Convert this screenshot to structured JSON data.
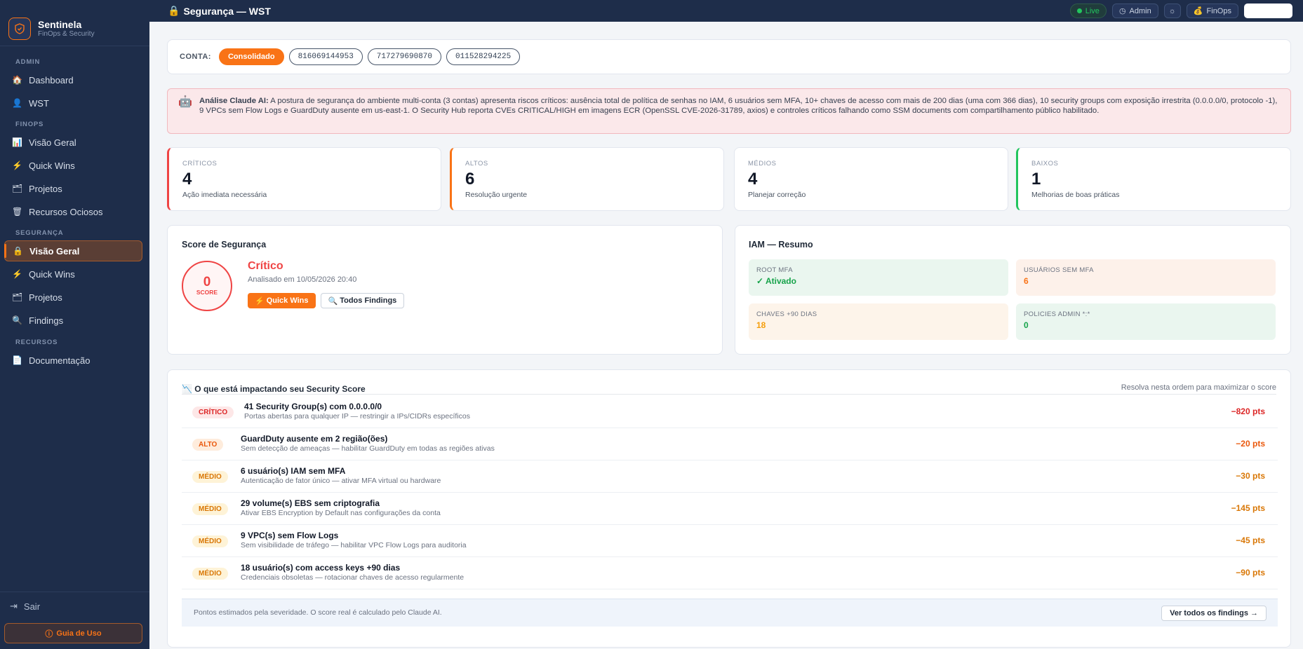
{
  "brand": {
    "name": "Sentinela",
    "subtitle": "FinOps & Security"
  },
  "nav": {
    "sections": [
      {
        "label": "ADMIN"
      },
      {
        "label": "FINOPS"
      },
      {
        "label": "SEGURANÇA"
      },
      {
        "label": "RECURSOS"
      }
    ],
    "items": [
      {
        "label": "Dashboard",
        "icon": "home-icon"
      },
      {
        "label": "WST",
        "icon": "user-icon"
      },
      {
        "label": "Visão Geral",
        "icon": "chart-icon"
      },
      {
        "label": "Quick Wins",
        "icon": "bolt-icon"
      },
      {
        "label": "Projetos",
        "icon": "folder-icon"
      },
      {
        "label": "Recursos Ociosos",
        "icon": "trash-icon"
      },
      {
        "label": "Visão Geral",
        "icon": "lock-icon",
        "active": true
      },
      {
        "label": "Quick Wins",
        "icon": "bolt-icon"
      },
      {
        "label": "Projetos",
        "icon": "folder-icon"
      },
      {
        "label": "Findings",
        "icon": "search-icon"
      },
      {
        "label": "Documentação",
        "icon": "document-icon"
      }
    ],
    "logout": "Sair",
    "guide": "Guia de Uso"
  },
  "topbar": {
    "title": "Segurança — WST",
    "live": "Live",
    "admin": "Admin",
    "finops": "FinOps"
  },
  "accounts": {
    "label": "CONTA:",
    "options": [
      "Consolidado",
      "816069144953",
      "717279690870",
      "011528294225"
    ],
    "selected": "Consolidado"
  },
  "analysis": {
    "title": "Análise Claude AI:",
    "text": "A postura de segurança do ambiente multi-conta (3 contas) apresenta riscos críticos: ausência total de política de senhas no IAM, 6 usuários sem MFA, 10+ chaves de acesso com mais de 200 dias (uma com 366 dias), 10 security groups com exposição irrestrita (0.0.0.0/0, protocolo -1), 9 VPCs sem Flow Logs e GuardDuty ausente em us-east-1. O Security Hub reporta CVEs CRITICAL/HIGH em imagens ECR (OpenSSL CVE-2026-31789, axios) e controles críticos falhando como SSM documents com compartilhamento público habilitado."
  },
  "stats": [
    {
      "label": "CRÍTICOS",
      "value": "4",
      "sub": "Ação imediata necessária",
      "color": "#ef4444"
    },
    {
      "label": "ALTOS",
      "value": "6",
      "sub": "Resolução urgente",
      "color": "#f97316"
    },
    {
      "label": "MÉDIOS",
      "value": "4",
      "sub": "Planejar correção",
      "color": "#e2e6ee"
    },
    {
      "label": "BAIXOS",
      "value": "1",
      "sub": "Melhorias de boas práticas",
      "color": "#22c55e"
    }
  ],
  "score": {
    "title": "Score de Segurança",
    "value": "0",
    "value_label": "SCORE",
    "status": "Crítico",
    "analyzed": "Analisado em 10/05/2026 20:40",
    "btn_quick": "Quick Wins",
    "btn_findings": "Todos Findings"
  },
  "iam": {
    "title": "IAM — Resumo",
    "boxes": [
      {
        "label": "ROOT MFA",
        "value": "✓ Ativado"
      },
      {
        "label": "USUÁRIOS SEM MFA",
        "value": "6"
      },
      {
        "label": "CHAVES +90 DIAS",
        "value": "18"
      },
      {
        "label": "POLICIES ADMIN *:*",
        "value": "0"
      }
    ]
  },
  "impact": {
    "title": "O que está impactando seu Security Score",
    "hint": "Resolva nesta ordem para maximizar o score",
    "rows": [
      {
        "severity": "CRÍTICO",
        "title": "41 Security Group(s) com 0.0.0.0/0",
        "desc": "Portas abertas para qualquer IP — restringir a IPs/CIDRs específicos",
        "pts": "−820 pts"
      },
      {
        "severity": "ALTO",
        "title": "GuardDuty ausente em 2 região(ões)",
        "desc": "Sem detecção de ameaças — habilitar GuardDuty em todas as regiões ativas",
        "pts": "−20 pts"
      },
      {
        "severity": "MÉDIO",
        "title": "6 usuário(s) IAM sem MFA",
        "desc": "Autenticação de fator único — ativar MFA virtual ou hardware",
        "pts": "−30 pts"
      },
      {
        "severity": "MÉDIO",
        "title": "29 volume(s) EBS sem criptografia",
        "desc": "Ativar EBS Encryption by Default nas configurações da conta",
        "pts": "−145 pts"
      },
      {
        "severity": "MÉDIO",
        "title": "9 VPC(s) sem Flow Logs",
        "desc": "Sem visibilidade de tráfego — habilitar VPC Flow Logs para auditoria",
        "pts": "−45 pts"
      },
      {
        "severity": "MÉDIO",
        "title": "18 usuário(s) com access keys +90 dias",
        "desc": "Credenciais obsoletas — rotacionar chaves de acesso regularmente",
        "pts": "−90 pts"
      }
    ],
    "footer_note": "Pontos estimados pela severidade. O score real é calculado pelo Claude AI.",
    "footer_button": "Ver todos os findings →"
  }
}
